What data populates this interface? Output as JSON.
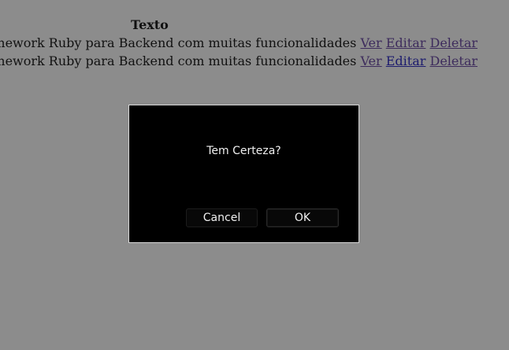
{
  "table": {
    "header": "Texto",
    "rows": [
      {
        "text": "nework Ruby para Backend com muitas funcionalidades",
        "view": "Ver",
        "edit": "Editar",
        "delete": "Deletar"
      },
      {
        "text": "nework Ruby para Backend com muitas funcionalidades",
        "view": "Ver",
        "edit": "Editar",
        "delete": "Deletar"
      }
    ]
  },
  "dialog": {
    "message": "Tem Certeza?",
    "cancel_label": "Cancel",
    "ok_label": "OK"
  },
  "colors": {
    "backdrop": "#8c8c8c",
    "dialog_bg": "#000000",
    "link": "#3d2b5c",
    "link_active": "#1c1b6e"
  }
}
